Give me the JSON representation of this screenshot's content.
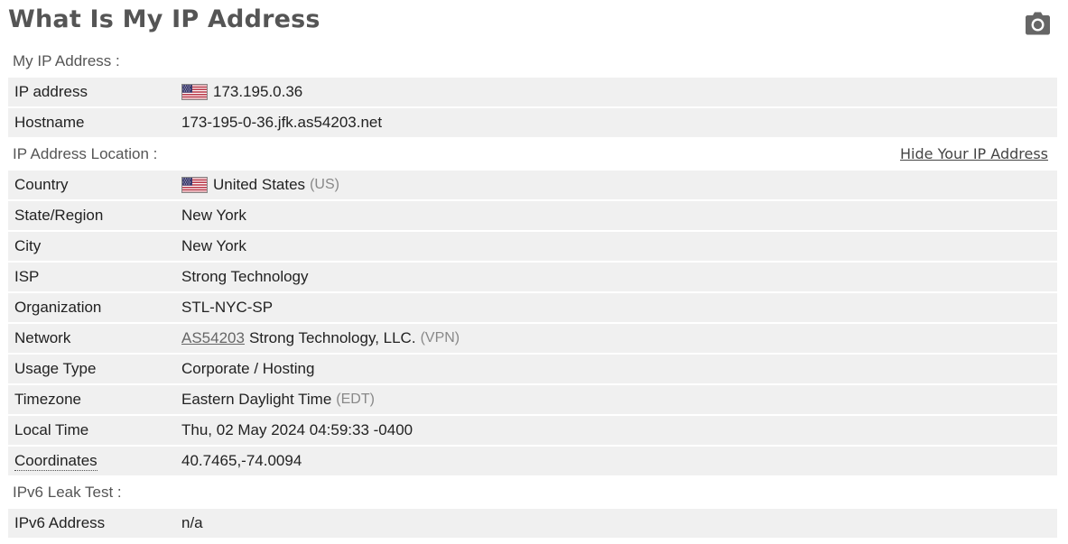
{
  "page": {
    "title": "What Is My IP Address",
    "camera_icon": "camera-icon"
  },
  "sections": {
    "my_ip": {
      "heading": "My IP Address :",
      "rows": {
        "ip": {
          "label": "IP address",
          "value": "173.195.0.36",
          "flag": "us-flag-icon"
        },
        "hostname": {
          "label": "Hostname",
          "value": "173-195-0-36.jfk.as54203.net"
        }
      }
    },
    "location": {
      "heading": "IP Address Location :",
      "hide_link": "Hide Your IP Address",
      "rows": {
        "country": {
          "label": "Country",
          "value": "United States",
          "extra": "(US)",
          "flag": "us-flag-icon"
        },
        "state": {
          "label": "State/Region",
          "value": "New York"
        },
        "city": {
          "label": "City",
          "value": "New York"
        },
        "isp": {
          "label": "ISP",
          "value": "Strong Technology"
        },
        "organization": {
          "label": "Organization",
          "value": "STL-NYC-SP"
        },
        "network": {
          "label": "Network",
          "asn_link": "AS54203",
          "value": "Strong Technology, LLC.",
          "extra": "(VPN)"
        },
        "usage": {
          "label": "Usage Type",
          "value": "Corporate / Hosting"
        },
        "timezone": {
          "label": "Timezone",
          "value": "Eastern Daylight Time",
          "extra": "(EDT)"
        },
        "local_time": {
          "label": "Local Time",
          "value": "Thu, 02 May 2024 04:59:33 -0400"
        },
        "coordinates": {
          "label": "Coordinates",
          "value": "40.7465,-74.0094"
        }
      }
    },
    "ipv6": {
      "heading": "IPv6 Leak Test :",
      "rows": {
        "ipv6_address": {
          "label": "IPv6 Address",
          "value": "n/a"
        }
      }
    }
  },
  "colors": {
    "row_background": "#f0f0f0",
    "title_text": "#555555",
    "muted_text": "#888888"
  }
}
